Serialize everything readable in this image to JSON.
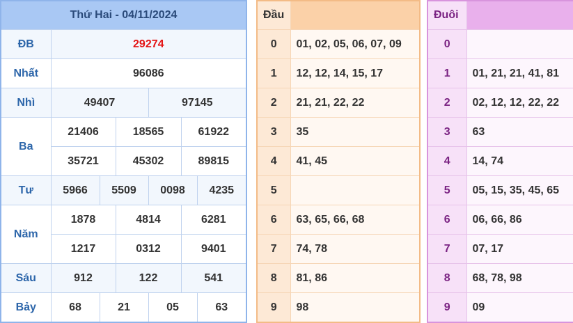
{
  "results": {
    "title": "Thứ Hai - 04/11/2024",
    "prizes": [
      {
        "label": "ĐB",
        "values": [
          "29274"
        ]
      },
      {
        "label": "Nhất",
        "values": [
          "96086"
        ]
      },
      {
        "label": "Nhì",
        "values": [
          "49407",
          "97145"
        ]
      },
      {
        "label": "Ba",
        "values": [
          "21406",
          "18565",
          "61922",
          "35721",
          "45302",
          "89815"
        ]
      },
      {
        "label": "Tư",
        "values": [
          "5966",
          "5509",
          "0098",
          "4235"
        ]
      },
      {
        "label": "Năm",
        "values": [
          "1878",
          "4814",
          "6281",
          "1217",
          "0312",
          "9401"
        ]
      },
      {
        "label": "Sáu",
        "values": [
          "912",
          "122",
          "541"
        ]
      },
      {
        "label": "Bảy",
        "values": [
          "68",
          "21",
          "05",
          "63"
        ]
      }
    ]
  },
  "dau": {
    "header": "Đầu",
    "rows": [
      {
        "digit": "0",
        "values": "01, 02, 05, 06, 07, 09"
      },
      {
        "digit": "1",
        "values": "12, 12, 14, 15, 17"
      },
      {
        "digit": "2",
        "values": "21, 21, 22, 22"
      },
      {
        "digit": "3",
        "values": "35"
      },
      {
        "digit": "4",
        "values": "41, 45"
      },
      {
        "digit": "5",
        "values": ""
      },
      {
        "digit": "6",
        "values": "63, 65, 66, 68"
      },
      {
        "digit": "7",
        "values": "74, 78"
      },
      {
        "digit": "8",
        "values": "81, 86"
      },
      {
        "digit": "9",
        "values": "98"
      }
    ]
  },
  "duoi": {
    "header": "Đuôi",
    "rows": [
      {
        "digit": "0",
        "values": ""
      },
      {
        "digit": "1",
        "values": "01, 21, 21, 41, 81"
      },
      {
        "digit": "2",
        "values": "02, 12, 12, 22, 22"
      },
      {
        "digit": "3",
        "values": "63"
      },
      {
        "digit": "4",
        "values": "14, 74"
      },
      {
        "digit": "5",
        "values": "05, 15, 35, 45, 65"
      },
      {
        "digit": "6",
        "values": "06, 66, 86"
      },
      {
        "digit": "7",
        "values": "07, 17"
      },
      {
        "digit": "8",
        "values": "68, 78, 98"
      },
      {
        "digit": "9",
        "values": "09"
      }
    ]
  },
  "colors": {
    "special_prize": "#e41414",
    "results_accent": "#a9c8f4",
    "dau_accent": "#fbd1a8",
    "duoi_accent": "#e9b0ec"
  }
}
